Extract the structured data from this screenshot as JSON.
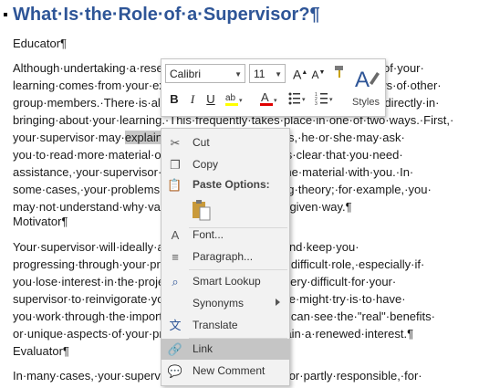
{
  "document": {
    "heading": "What·Is·the·Role·of·a·Supervisor?¶",
    "sections": [
      {
        "title": "Educator¶",
        "lines": [
          "Although·undertaking·a·research·project·is·a·self-directed·task,·much·of·your·",
          "learning·comes·from·your·experience·with·the·supervisor·and·the·views·of·other·",
          "group·members.·There·is·also·a·strong·role·for·the·supervisor·to·play·directly·in·",
          "bringing·about·your·learning.·This·frequently·takes·place·in·one·of·two·ways.·First,·",
          "your·supervisor·may·",
          "you·to·read·more·material·on·a·particular·topic·if·it·is·clear·that·you·need·",
          "assistance,·your·supervisor·may·take·you·through·the·material·with·you.·In·",
          "some·cases,·your·problems·may·lie·in·understanding·theory;·for·example,·you·",
          "may·not·understand·why·values·are·expressed·in·a·given·way.¶"
        ],
        "line4_highlight": "explain",
        "line4_rest": "·it·to·you.·In·some·cases,·he·or·she·may·ask·"
      },
      {
        "title": "Motivator¶",
        "lines": [
          "Your·supervisor·will·ideally·also·act·as·a·motivator·and·keep·you·",
          "progressing·through·your·project·as·this·is·the·most·difficult·role,·especially·if·",
          "you·lose·interest·in·the·project.·In·such·cases,·it·is·very·difficult·for·your·",
          "supervisor·to·reinvigorate·your·interest,·but·he·or·she·might·try·is·to·have·",
          "you·work·through·the·important·aspects·so·that·you·can·see·the·\"real\"·benefits·",
          "or·unique·aspects·of·your·project·so·that·you·can·gain·a·renewed·interest.¶"
        ]
      },
      {
        "title": "Evaluator¶",
        "lines": [
          "In·many·cases,·your·supervisor·will·be·responsible,·or·partly·responsible,·for·"
        ]
      }
    ]
  },
  "mini_toolbar": {
    "font": "Calibri",
    "size": "11",
    "styles_label": "Styles"
  },
  "context_menu": {
    "items": {
      "cut": "Cut",
      "copy": "Copy",
      "paste_options": "Paste Options:",
      "font": "Font...",
      "paragraph": "Paragraph...",
      "smart_lookup": "Smart Lookup",
      "synonyms": "Synonyms",
      "translate": "Translate",
      "link": "Link",
      "new_comment": "New Comment"
    }
  },
  "colors": {
    "heading": "#2e5597",
    "highlight": "#ffff00",
    "font_color": "#e00000",
    "menu_hover": "#c5c5c5"
  }
}
